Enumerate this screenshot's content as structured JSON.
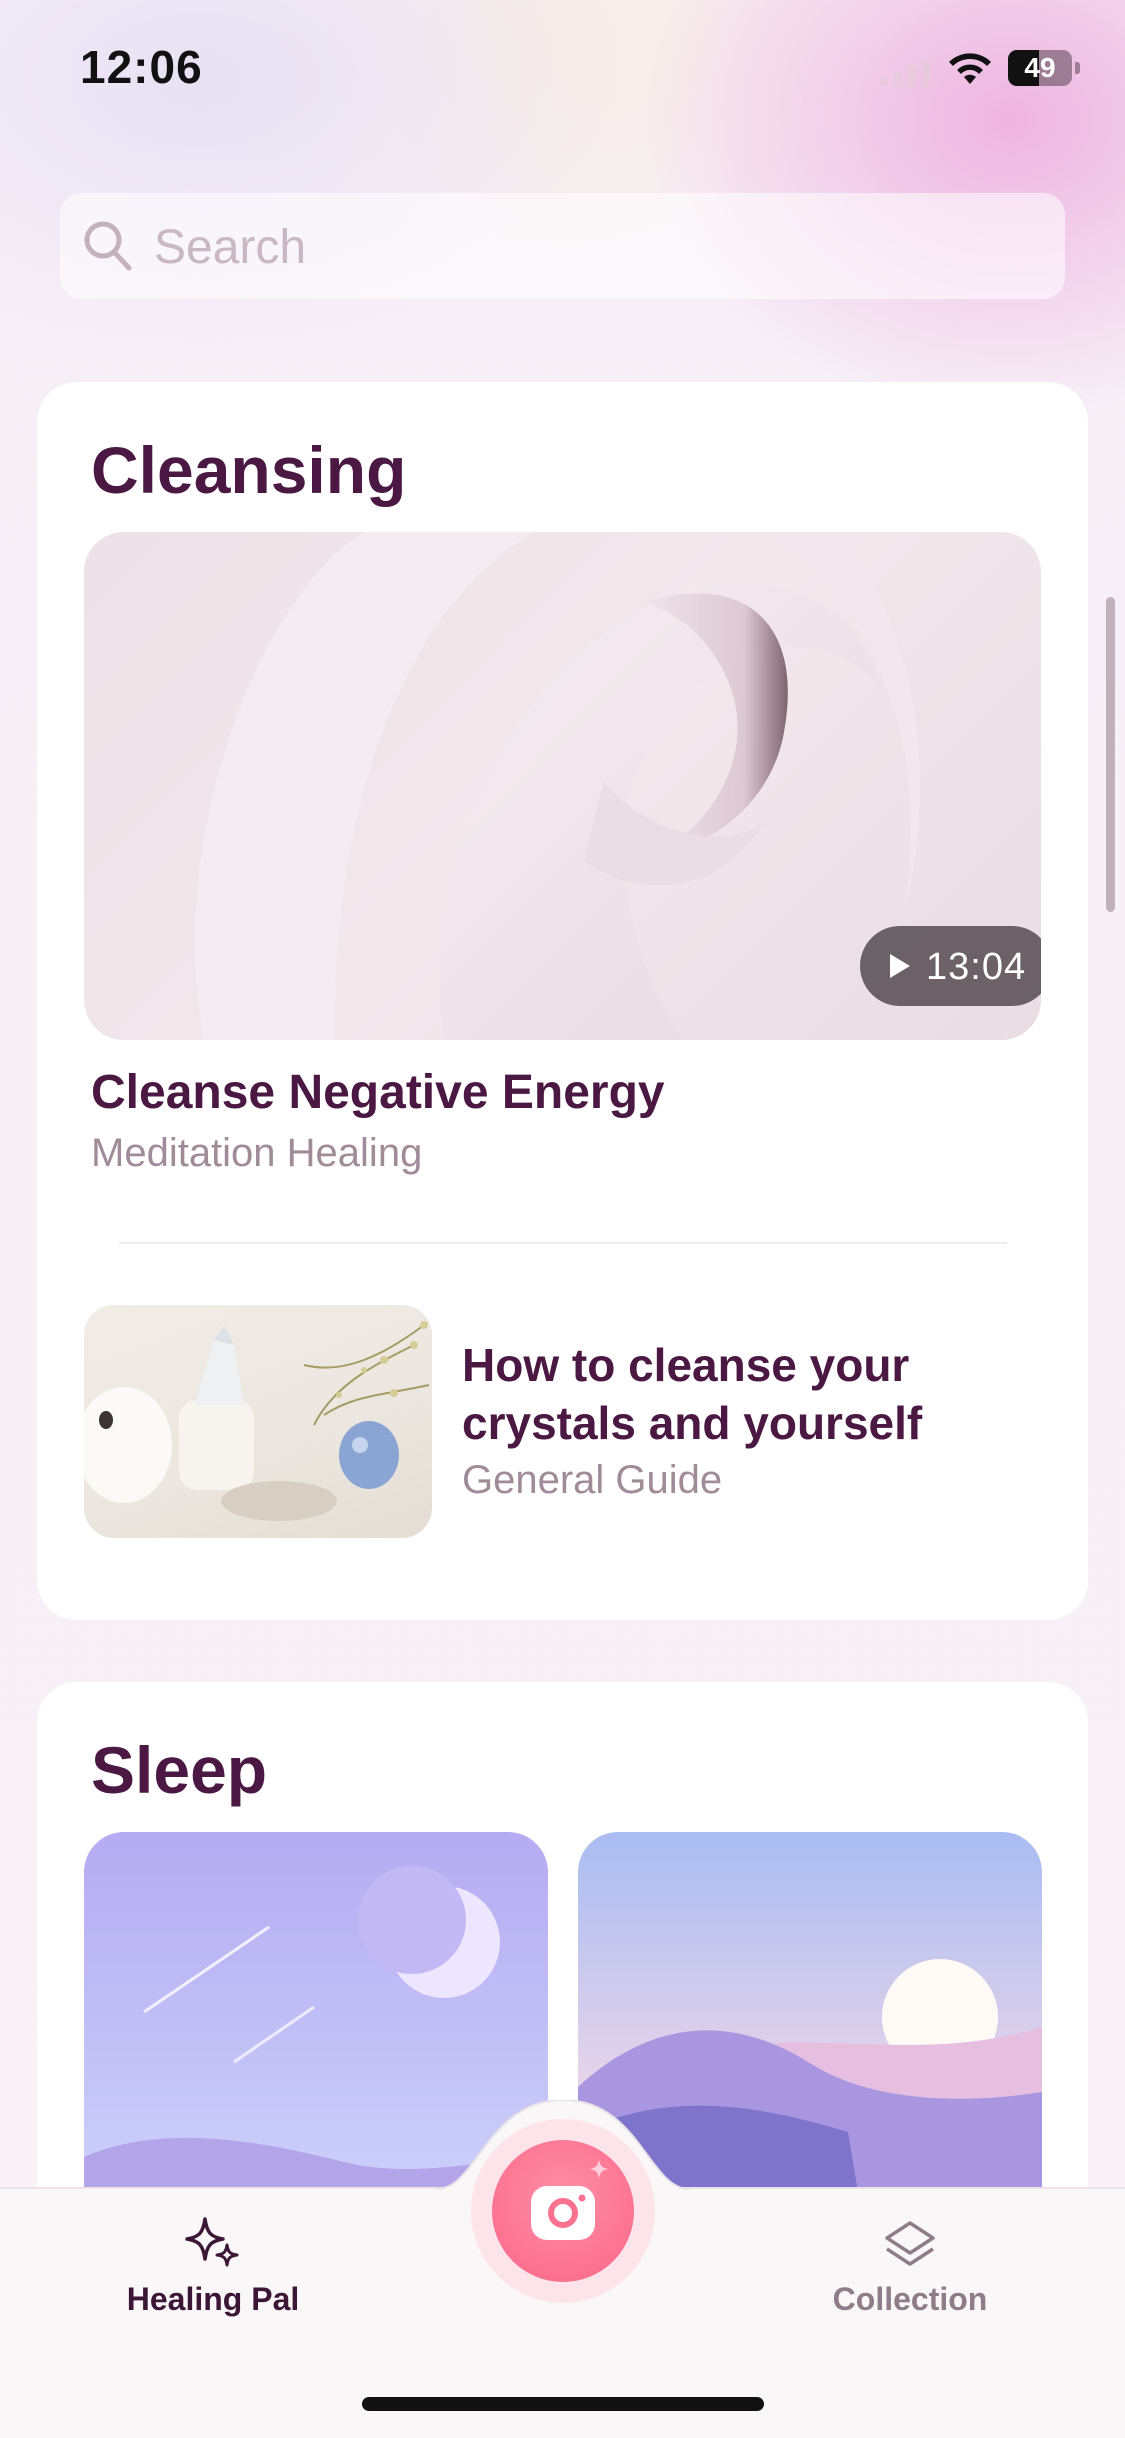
{
  "status_bar": {
    "time": "12:06",
    "battery": "49",
    "battery_level": 0.49
  },
  "search": {
    "placeholder": "Search",
    "value": ""
  },
  "sections": [
    {
      "title": "Cleansing",
      "featured": {
        "title": "Cleanse Negative Energy",
        "subtitle": "Meditation Healing",
        "duration": "13:04"
      },
      "items": [
        {
          "title_line1": "How to cleanse your",
          "title_line2": "crystals and yourself",
          "subtitle": "General Guide"
        }
      ]
    },
    {
      "title": "Sleep"
    }
  ],
  "tabbar": {
    "left": {
      "label": "Healing Pal",
      "icon": "sparkles-icon"
    },
    "center": {
      "icon": "camera-icon"
    },
    "right": {
      "label": "Collection",
      "icon": "layers-icon"
    }
  },
  "colors": {
    "heading": "#4a1842",
    "subtle": "#a08c99",
    "accent": "#fb7290"
  }
}
